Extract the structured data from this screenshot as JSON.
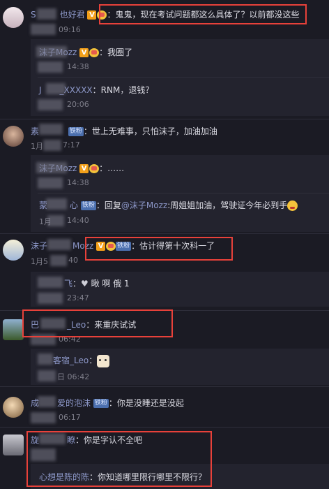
{
  "comments": [
    {
      "user": "S",
      "user_suffix": "也好君",
      "text": "：鬼鬼，现在考试问题都这么具体了？以前都没这些",
      "time": "09:16",
      "replies": [
        {
          "user": "沫子Mozz",
          "text": "：我圈了",
          "time": "14:38"
        },
        {
          "user": "J",
          "user_suffix": "_XXXXX",
          "text": "：RNM，退钱？",
          "time": "20:06"
        }
      ]
    },
    {
      "user": "素",
      "badge": "铁粉",
      "text": "：世上无难事，只怕沫子，加油加油",
      "time": "1月",
      "time2": "7:17",
      "replies": [
        {
          "user": "沫子Mozz",
          "text": "：……",
          "time": "14:38"
        },
        {
          "user": "蒙",
          "user_suffix": "心",
          "badge": "铁粉",
          "text": "：回复",
          "at": "@沫子Mozz",
          "text2": ":周姐姐加油，驾驶证今年必到手",
          "time": "1月",
          "time2": "14:40"
        }
      ]
    },
    {
      "user": "沫子",
      "user_suffix": "Mozz",
      "badge": "铁粉",
      "text": "：估计得第十次科一了",
      "time": "1月5",
      "time2": "40",
      "replies": [
        {
          "user": "",
          "user_suffix": "飞",
          "text": "：",
          "heart": "♥",
          "text2": "  瞅    啊    俄    1",
          "time": "23:47"
        }
      ]
    },
    {
      "user": "巴",
      "user_suffix": "_Leo",
      "text": "：来重庆试试",
      "time": "06:42",
      "replies": [
        {
          "user": "",
          "user_suffix": "客宿_Leo",
          "text": "：",
          "time": "日 06:42"
        }
      ]
    },
    {
      "user": "成",
      "user_suffix": "爱的泡沫",
      "badge": "铁粉",
      "text": "：你是没睡还是没起",
      "time": "06:17"
    },
    {
      "user": "旋",
      "user_suffix": "瞭",
      "text": "：你是字认不全吧",
      "time": "",
      "replies": [
        {
          "user": "心想是陈的陈",
          "text": "：你知道哪里限行哪里不限行？",
          "time": ""
        }
      ]
    }
  ],
  "icons": {
    "verified": "V",
    "crown": "crown-icon",
    "emoji": "crying-laugh-emoji-icon",
    "cat": "cat-emoji-icon"
  },
  "colors": {
    "background": "#1b1b24",
    "reply_background": "#23232e",
    "username": "#8d98c9",
    "highlight": "#e8413a"
  }
}
